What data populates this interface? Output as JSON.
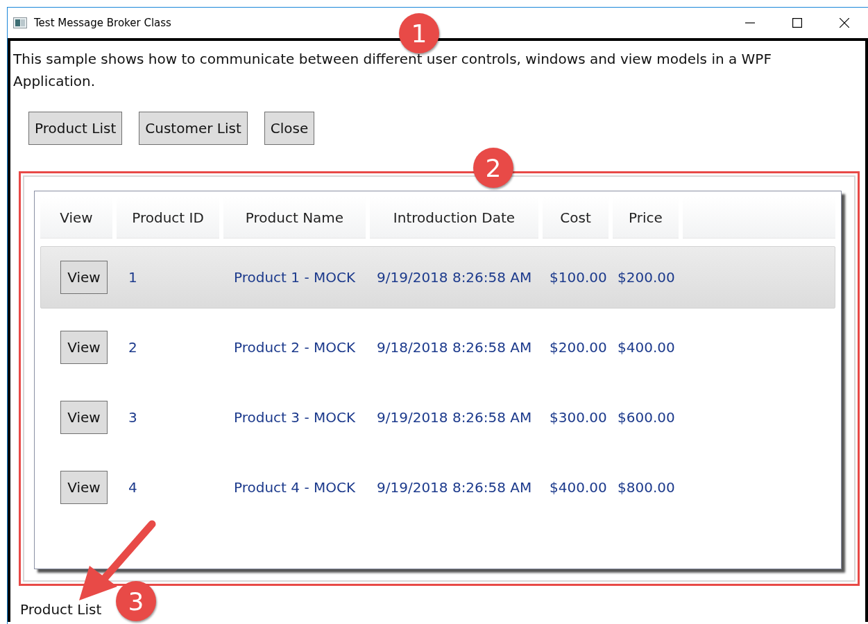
{
  "window": {
    "title": "Test Message Broker Class"
  },
  "description": "This sample shows how to communicate between different user controls, windows and view models in a WPF Application.",
  "buttons": [
    "Product List",
    "Customer List",
    "Close"
  ],
  "table": {
    "columns": [
      "View",
      "Product ID",
      "Product Name",
      "Introduction Date",
      "Cost",
      "Price"
    ],
    "rows": [
      {
        "button": "View",
        "id": "1",
        "name": "Product 1 - MOCK",
        "date": "9/19/2018 8:26:58 AM",
        "cost": "$100.00",
        "price": "$200.00",
        "selected": true
      },
      {
        "button": "View",
        "id": "2",
        "name": "Product 2 - MOCK",
        "date": "9/18/2018 8:26:58 AM",
        "cost": "$200.00",
        "price": "$400.00",
        "selected": false
      },
      {
        "button": "View",
        "id": "3",
        "name": "Product 3 - MOCK",
        "date": "9/19/2018 8:26:58 AM",
        "cost": "$300.00",
        "price": "$600.00",
        "selected": false
      },
      {
        "button": "View",
        "id": "4",
        "name": "Product 4 - MOCK",
        "date": "9/19/2018 8:26:58 AM",
        "cost": "$400.00",
        "price": "$800.00",
        "selected": false
      }
    ]
  },
  "status_bar": "Product List",
  "callouts": [
    "1",
    "2",
    "3"
  ]
}
